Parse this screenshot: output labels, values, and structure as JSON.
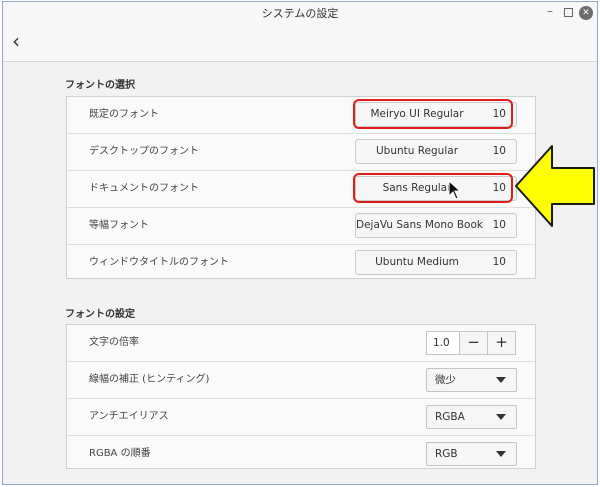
{
  "window": {
    "title": "システムの設定",
    "minimize_label": "–",
    "close_label": "✕",
    "back_label": "‹"
  },
  "font_selection": {
    "title": "フォントの選択",
    "rows": [
      {
        "label": "既定のフォント",
        "font": "Meiryo UI Regular",
        "size": "10"
      },
      {
        "label": "デスクトップのフォント",
        "font": "Ubuntu Regular",
        "size": "10"
      },
      {
        "label": "ドキュメントのフォント",
        "font": "Sans Regular",
        "size": "10"
      },
      {
        "label": "等幅フォント",
        "font": "DejaVu Sans Mono Book",
        "size": "10"
      },
      {
        "label": "ウィンドウタイトルのフォント",
        "font": "Ubuntu Medium",
        "size": "10"
      }
    ]
  },
  "font_settings": {
    "title": "フォントの設定",
    "scale": {
      "label": "文字の倍率",
      "value": "1.0",
      "minus": "−",
      "plus": "+"
    },
    "hinting": {
      "label": "線幅の補正 (ヒンティング)",
      "value": "微少"
    },
    "antialias": {
      "label": "アンチエイリアス",
      "value": "RGBA"
    },
    "rgba_order": {
      "label": "RGBA の順番",
      "value": "RGB"
    }
  },
  "colors": {
    "highlight": "#e01c1c",
    "callout_fill": "#ffff00"
  }
}
